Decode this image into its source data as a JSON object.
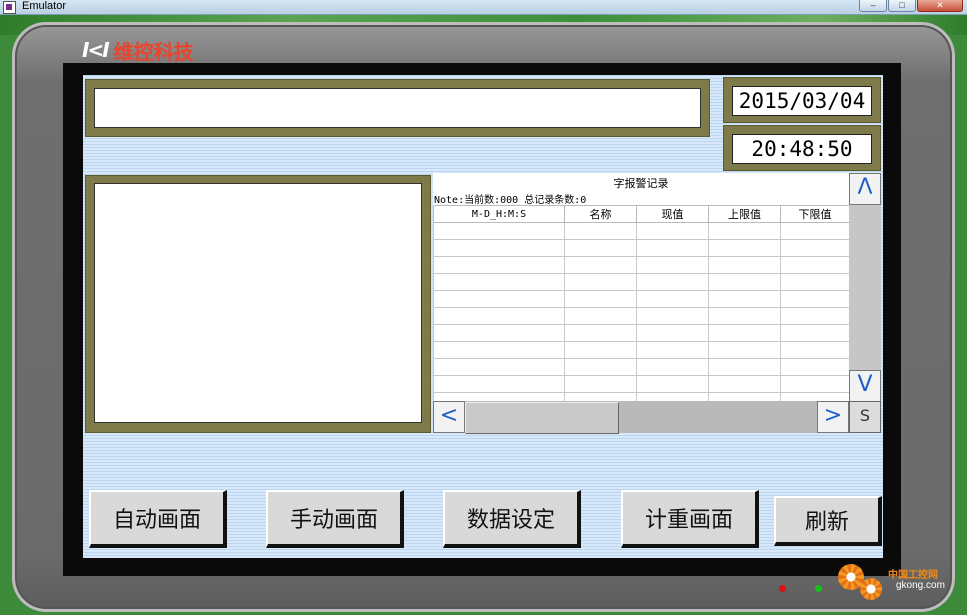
{
  "window": {
    "title": "Emulator"
  },
  "brand": {
    "logo": "I<I",
    "name": "维控科技"
  },
  "display": {
    "date": "2015/03/04",
    "time": "20:48:50"
  },
  "alarm": {
    "title": "字报警记录",
    "note": "Note:当前数:000 总记录条数:0",
    "columns": [
      "M-D_H:M:S",
      "名称",
      "现值",
      "上限值",
      "下限值"
    ],
    "empty_rows": 11
  },
  "scroll": {
    "up": "Λ",
    "down": "V",
    "left": "<",
    "right": ">",
    "corner": "S"
  },
  "buttons": {
    "auto": "自动画面",
    "manual": "手动画面",
    "data_set": "数据设定",
    "weigh": "计重画面",
    "refresh": "刷新"
  },
  "watermark": {
    "cn": "中国工控网",
    "url": "gkong.com"
  },
  "colors": {
    "olive": "#7f7a4a",
    "accent_blue": "#1e5dc8",
    "led_red": "#e01010",
    "led_green": "#18c018"
  }
}
